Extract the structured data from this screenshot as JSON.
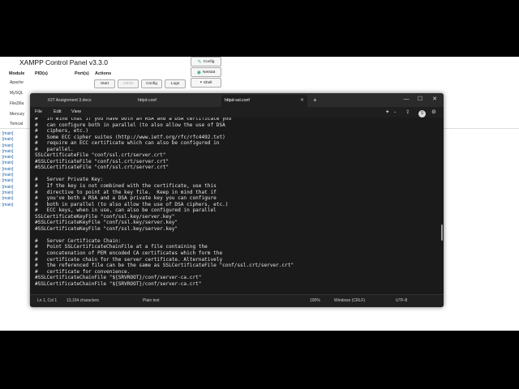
{
  "xampp": {
    "title": "XAMPP Control Panel v3.3.0",
    "headers": {
      "module": "Module",
      "pids": "PID(s)",
      "ports": "Port(s)",
      "actions": "Actions"
    },
    "modules": [
      "Apache",
      "MySQL",
      "FileZilla",
      "Mercury",
      "Tomcat"
    ],
    "buttons": {
      "start": "Start",
      "admin": "Admin",
      "config": "Config",
      "logs": "Logs"
    },
    "side_buttons": {
      "config": "Config",
      "netstat": "Netstat",
      "shell": "Shell"
    },
    "log_tag": "[main]",
    "log_count": 13
  },
  "notepad": {
    "tabs": [
      {
        "label": "IOT Assignment 3.docx"
      },
      {
        "label": "httpd.conf"
      },
      {
        "label": "httpd-ssl.conf",
        "active": true
      }
    ],
    "new_tab": "+",
    "menus": [
      "File",
      "Edit",
      "View"
    ],
    "avatar_initial": "S",
    "lines": [
      "#   in mind that if you have both an RSA and a DSA certificate you",
      "#   can configure both in parallel (to also allow the use of DSA",
      "#   ciphers, etc.)",
      "#   Some ECC cipher suites (http://www.ietf.org/rfc/rfc4492.txt)",
      "#   require an ECC certificate which can also be configured in",
      "#   parallel.",
      "SSLCertificateFile \"conf/ssl.crt/server.crt\"",
      "#SSLCertificateFile \"conf/ssl.crt/server.crt\"",
      "#SSLCertificateFile \"conf/ssl.crt/server.crt\"",
      "",
      "#   Server Private Key:",
      "#   If the key is not combined with the certificate, use this",
      "#   directive to point at the key file.  Keep in mind that if",
      "#   you've both a RSA and a DSA private key you can configure",
      "#   both in parallel (to also allow the use of DSA ciphers, etc.)",
      "#   ECC keys, when in use, can also be configured in parallel",
      "SSLCertificateKeyFile \"conf/ssl.key/server.key\"",
      "#SSLCertificateKeyFile \"conf/ssl.key/server.key\"",
      "#SSLCertificateKeyFile \"conf/ssl.key/server.key\"",
      "",
      "#   Server Certificate Chain:",
      "#   Point SSLCertificateChainFile at a file containing the",
      "#   concatenation of PEM encoded CA certificates which form the",
      "#   certificate chain for the server certificate. Alternatively",
      "#   the referenced file can be the same as SSLCertificateFile \"conf/ssl.crt/server.crt\"",
      "#   certificate for convenience.",
      "#SSLCertificateChainFile \"${SRVROOT}/conf/server-ca.crt\"",
      "#SSLCertificateChainFile \"${SRVROOT}/conf/server-ca.crt\""
    ],
    "status": {
      "position": "Ln 1, Col 1",
      "characters": "13,154 characters",
      "format": "Plain text",
      "zoom": "100%",
      "line_endings": "Windows (CRLF)",
      "encoding": "UTF-8"
    }
  }
}
